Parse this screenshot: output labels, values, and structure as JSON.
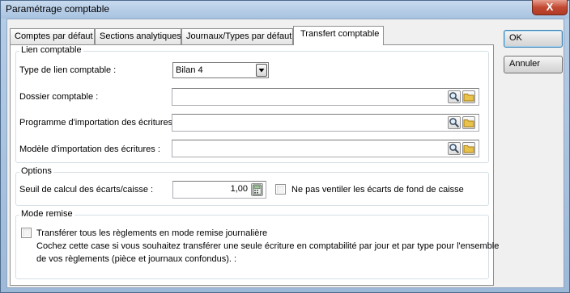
{
  "window": {
    "title": "Paramétrage comptable",
    "close_glyph": "X"
  },
  "tabs": [
    {
      "label": "Comptes par défaut",
      "active": false
    },
    {
      "label": "Sections analytiques",
      "active": false
    },
    {
      "label": "Journaux/Types par défaut",
      "active": false
    },
    {
      "label": "Transfert comptable",
      "active": true
    }
  ],
  "lien_comptable": {
    "group_label": "Lien comptable",
    "type_lien": {
      "label": "Type de lien comptable :",
      "value": "Bilan 4"
    },
    "dossier": {
      "label": "Dossier comptable :",
      "value": ""
    },
    "programme": {
      "label": "Programme d'importation des écritures :",
      "value": ""
    },
    "modele": {
      "label": "Modèle d'importation des écritures :",
      "value": ""
    },
    "icons": {
      "search": "search-icon",
      "folder": "folder-icon",
      "dropdown": "chevron-down-icon"
    }
  },
  "options": {
    "group_label": "Options",
    "seuil": {
      "label": "Seuil de calcul des écarts/caisse :",
      "value": "1,00"
    },
    "ne_pas_ventiler": {
      "label": "Ne pas ventiler les écarts de fond de caisse",
      "checked": false
    },
    "icons": {
      "calculator": "calculator-icon"
    }
  },
  "mode_remise": {
    "group_label": "Mode remise",
    "transferer": {
      "label": "Transférer tous les règlements en mode remise journalière",
      "checked": false
    },
    "help_line1": "Cochez cette case si vous souhaitez transférer une seule écriture en comptabilité par jour et par type pour l'ensemble",
    "help_line2": "de vos règlements (pièce et journaux confondus). :"
  },
  "buttons": {
    "ok": "OK",
    "cancel": "Annuler"
  },
  "colors": {
    "title_bar": "#b6cde6",
    "close_button": "#c24a33",
    "folder": "#e8c24a"
  }
}
